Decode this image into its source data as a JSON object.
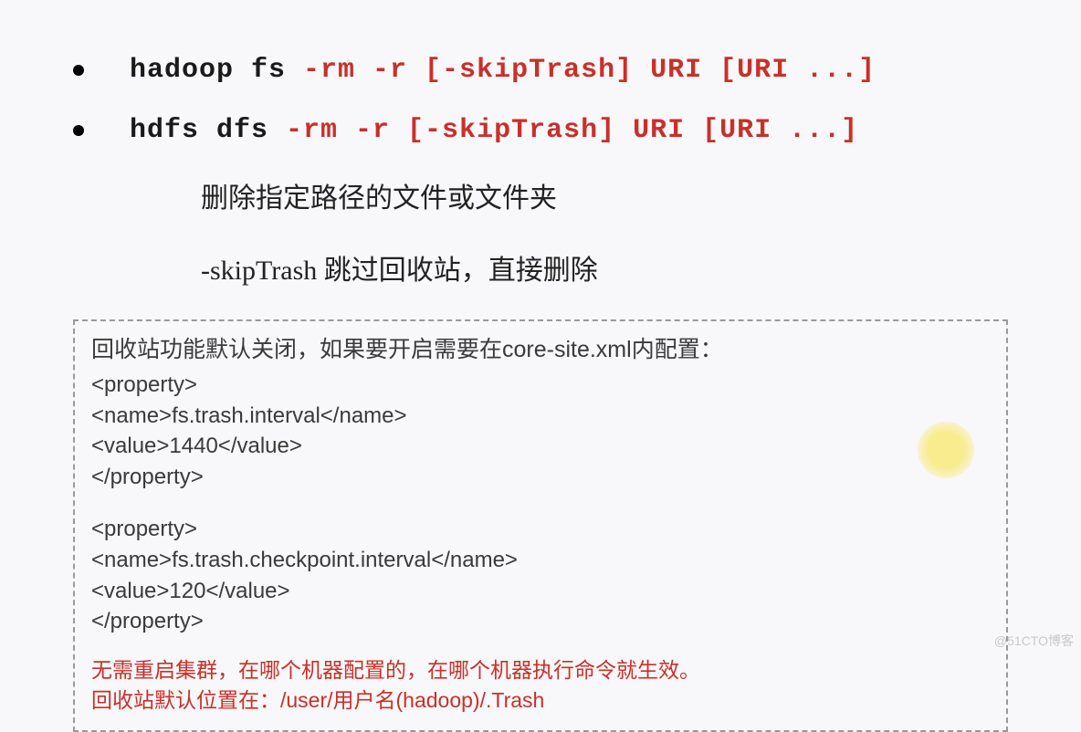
{
  "commands": [
    {
      "black": "hadoop fs ",
      "red": "-rm -r [-skipTrash] URI [URI ...]"
    },
    {
      "black": "hdfs dfs ",
      "red": "-rm -r [-skipTrash] URI [URI ...]"
    }
  ],
  "desc": {
    "line1": "删除指定路径的文件或文件夹",
    "line2": "-skipTrash 跳过回收站，直接删除"
  },
  "box": {
    "intro": "回收站功能默认关闭，如果要开启需要在core-site.xml内配置：",
    "xml": [
      "<property>",
      "<name>fs.trash.interval</name>",
      "<value>1440</value>",
      "</property>",
      "",
      "<property>",
      "<name>fs.trash.checkpoint.interval</name>",
      "<value>120</value>",
      "</property>"
    ],
    "note1": "无需重启集群，在哪个机器配置的，在哪个机器执行命令就生效。",
    "note2": "回收站默认位置在：/user/用户名(hadoop)/.Trash"
  },
  "watermark": "@51CTO博客"
}
